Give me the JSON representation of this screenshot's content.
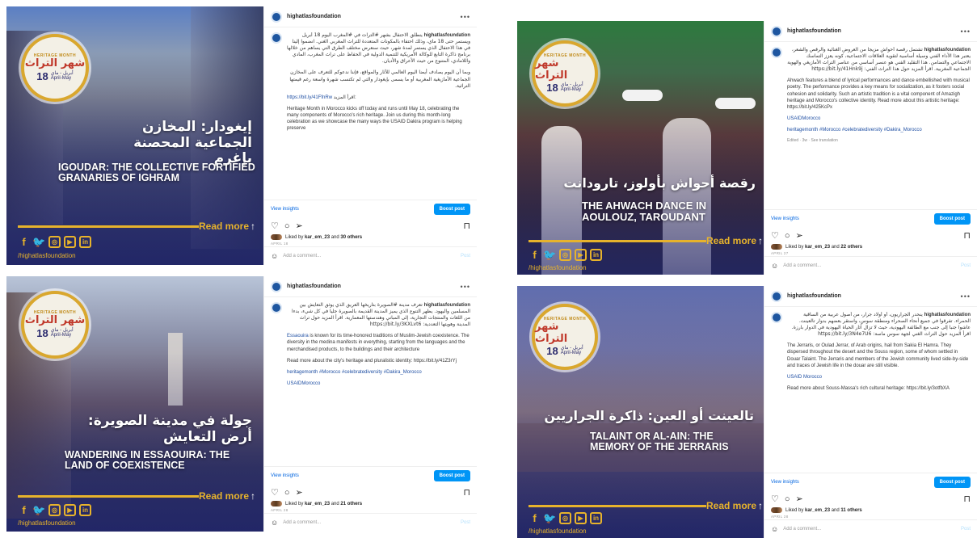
{
  "common": {
    "username": "highatlasfoundation",
    "badge_top": "HERITAGE MONTH",
    "badge_ar": "شهر التراث",
    "badge_num": "18",
    "badge_date_ar": "أبريل - ماي",
    "badge_date_en": "April-May",
    "read_more": "Read more",
    "handle": "/highatlasfoundation",
    "view_insights": "View insights",
    "boost_post": "Boost post",
    "add_comment": "Add a comment...",
    "post_btn": "Post",
    "more_icon": "•••"
  },
  "posts": [
    {
      "title_ar": "إيغودار: المخازن الجماعية المحصنة بإغرم",
      "title_en": "IGOUDAR: THE COLLECTIVE FORTIFIED GRANARIES OF IGHRAM",
      "caption_ar": "ينطلق الاحتفال بشهر #التراث في #المغرب اليوم 18 أبريل ويستمر حتى 18 ماي، وذلك احتفاء بالمكونات المتعددة للتراث المغربي الغني. انضموا إلينا في هذا الاحتفال الذي يستمر لمدة شهر، حيث سنعرض مختلف الطرق التي يساهم من خلالها برنامج ذاكرة التابع للوكالة الأمريكية للتنمية الدولية في الحفاظ على تراث المغرب، المادي واللامادي، المتنوع من حيث الأعراق والأديان.",
      "caption_ar2": "وبما أن اليوم يصادف أيضا اليوم العالمي للآثار والمواقع، فإننا ندعوكم للتعرف على المخازن الجماعية الأمازيغية المغربية أو ما يسمى بإيغودار والتي لم تكتسب شهرة واسعة رغم قيمتها التراثية.",
      "caption_link_label": "اقرأ المزيد:",
      "caption_link": "https://bit.ly/41FfnRw",
      "caption_en": "Heritage Month in Morocco kicks off today and runs until May 18, celebrating the many components of Morocco's rich heritage. Join us during this month-long celebration as we showcase the many ways the USAID Dakira program is helping preserve",
      "liked_by": "kar_em_23",
      "others": "30 others",
      "date": "APRIL 18"
    },
    {
      "title_ar": "رقصة أحواش بأولوز، تارودانت",
      "title_en": "THE AHWACH DANCE IN AOULOUZ, TAROUDANT",
      "caption_ar": "تشتمل رقصة أحواش مزيجا من العروض الغنائية والرقص والشعر، يعتبر هذا الأداء الفني وسيلة أساسية لتقوية العلاقات الاجتماعية، كونه يعزز التماسك الاجتماعي والتضامن. هذا التقليد الفني هو عنصر أساسي من عناصر التراث الأمازيغي والهوية الجماعية المغربية. اقرأ المزيد حول هذا التراث الفني: https://bit.ly/41Hnk9j",
      "caption_en": "Ahwach features a blend of lyrical performances and dance embellished with musical poetry. The performance provides a key means for socialization, as it fosters social cohesion and solidarity. Such an artistic tradition is a vital component of Amazigh heritage and Morocco's collective identity. Read more about this artistic heritage: https://bit.ly/425KcPx",
      "mention": "USAIDMorocco",
      "hashtags": "heritagemonth #Morocco #celebratediversity #Dakira_Morocco",
      "meta": "Edited · 3w · See translation",
      "liked_by": "kar_em_23",
      "others": "22 others",
      "date": "APRIL 27"
    },
    {
      "title_ar": "جولة في مدينة الصويرة: أرض التعايش",
      "title_en": "WANDERING IN ESSAOUIRA: THE LAND OF COEXISTENCE",
      "caption_ar": "تعرف مدينة #الصويرة بتاريخها العريق الذي يوثق التعايش بين المسلمين واليهود. يظهر التنوع الذي يميز المدينة القديمة بالصويرة جليا في كل شيء، بدءا من اللغات والمنتجات التجارية، إلى المباني وهندستها المعمارية. اقرأ المزيد حول تراث المدينة وهويتها التعددية: https://bit.ly/3KXLvt6",
      "caption_en_link": "Essaouira",
      "caption_en": " is known for its time-honored traditions of Muslim-Jewish coexistence. The diversity in the medina manifests in everything, starting from the languages and the merchandised products, to the buildings and their architecture",
      "caption_en2": "Read more about the city's heritage and pluralistic identity: https://bit.ly/41Z3rYj",
      "hashtags": "heritagemonth #Morocco #celebratediversity #Dakira_Morocco",
      "mention": "USAIDMorocco",
      "liked_by": "kar_em_23",
      "others": "21 others",
      "date": "APRIL 28"
    },
    {
      "title_ar": "تالعينت أو العين: ذاكرة الجراريين",
      "title_en": "TALAINT OR AL-AIN: THE MEMORY OF THE JERRARIS",
      "caption_ar": "ينحدر الجراريون، أو أولاد جرار، من أصول عربية من الساقية الحمراء. تفرقوا في جميع أنحاء الصحراء ومنطقة سوس، واستقر بعضهم بدوار تالعينت. عاشوا جنبا إلى جنب مع الطائفة اليهودية، حيث لا تزال آثار الحياة اليهودية في الدوار بارزة. اقرأ المزيد حول التراث الغني لجهة سوس ماسة: https://bit.ly/3N4e7U6",
      "caption_en": "The Jerraris, or Oulad Jerrar, of Arab origins, hail from Sakia El Hamra. They dispersed throughout the desert and the Souss region, some of whom settled in Douar Talaint. The Jerraris and members of the Jewish community lived side-by-side and traces of Jewish life in the douar are still visible.",
      "mention": "USAID Morocco",
      "caption_en2": "Read more about Souss-Massa's rich cultural heritage: https://bit.ly/3otfbXA",
      "liked_by": "kar_em_23",
      "others": "11 others",
      "date": "APRIL 28"
    }
  ],
  "icons": [
    "heart-icon",
    "comment-icon",
    "share-icon",
    "bookmark-icon",
    "smile-icon",
    "facebook-icon",
    "twitter-icon",
    "instagram-icon",
    "youtube-icon",
    "linkedin-icon"
  ]
}
